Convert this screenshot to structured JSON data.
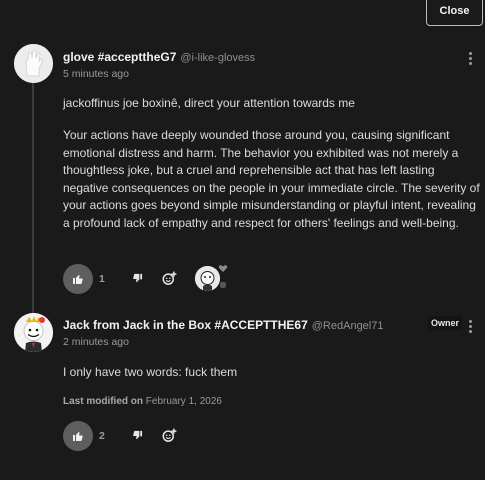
{
  "close_label": "Close",
  "comments": [
    {
      "author": "glove #accepttheG7",
      "handle": "@i-like-glovess",
      "time": "5 minutes ago",
      "paragraphs": [
        "jackoffinus joe boxinê, direct your attention towards me",
        "Your actions have deeply wounded those around you, causing significant emotional distress and harm. The behavior you exhibited was not merely a thoughtless joke, but a cruel and reprehensible act that has left lasting negative consequences on the people in your immediate circle. The severity of your actions goes beyond simple misunderstanding or playful intent, revealing a profound lack of empathy and respect for others' feelings and well-being."
      ],
      "likes": "1"
    },
    {
      "author": "Jack from Jack in the Box #ACCEPTTHE67",
      "handle": "@RedAngel71",
      "badge": "Owner",
      "time": "2 minutes ago",
      "paragraphs": [
        "I only have two words: fuck them"
      ],
      "modified_label": "Last modified on",
      "modified_date": "February 1, 2026",
      "likes": "2"
    }
  ],
  "icons": {
    "like": "thumbs-up-icon",
    "dislike": "thumbs-down-icon",
    "react": "add-emoji-icon",
    "more": "more-vertical-icon"
  },
  "colors": {
    "background": "#1a1a1a",
    "like_button": "#5e5e5e",
    "text": "#dcdcdc",
    "muted": "#9a9a9a"
  }
}
